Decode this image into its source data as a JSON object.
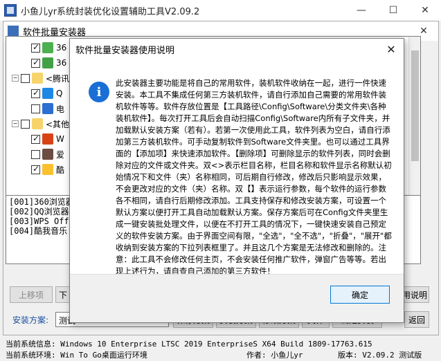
{
  "app": {
    "title": "小鱼儿yr系统封装优化设置辅助工具V2.09.2",
    "minimize_glyph": "—",
    "maximize_glyph": "☐",
    "close_glyph": "✕"
  },
  "installer": {
    "title": "软件批量安装器",
    "close_glyph": "✕",
    "tree": [
      {
        "label": "36",
        "checked": true,
        "icon": "360-green-icon"
      },
      {
        "label": "36",
        "checked": true,
        "icon": "360-green-icon"
      },
      {
        "label": "<腾讯",
        "checked": false,
        "icon": "folder-icon",
        "group": true
      },
      {
        "label": "Q",
        "checked": true,
        "icon": "qq-browser-icon"
      },
      {
        "label": "电",
        "checked": false,
        "icon": "shield-blue-icon"
      },
      {
        "label": "<其他",
        "checked": false,
        "icon": "folder-icon",
        "group": true
      },
      {
        "label": "W",
        "checked": true,
        "icon": "wps-icon"
      },
      {
        "label": "爱",
        "checked": false,
        "icon": "ai-icon"
      },
      {
        "label": "酷",
        "checked": true,
        "icon": "kugou-icon"
      }
    ],
    "log_lines": [
      "[001]360浏览器",
      "[002]QQ浏览器",
      "[003]WPS Offic",
      "[004]酷我音乐"
    ],
    "buttons": {
      "up": "上移项",
      "down": "下",
      "help": "用说明",
      "save": "保存方案",
      "apply": "安装方案",
      "edit": "修改方案",
      "extra": "文件",
      "confirm": "确定安装",
      "back": "返回"
    },
    "scheme_label": "安装方案:",
    "scheme_value": "测试"
  },
  "status": {
    "sysinfo": "当前系统信息: Windows 10 Enterprise LTSC 2019 EnterpriseS X64 Build 1809-17763.615",
    "sysenv": "当前系统环境: Win To Go桌面运行环境",
    "author": "作者: 小鱼儿yr",
    "version": "版本: V2.09.2 测试版"
  },
  "dialog": {
    "title": "软件批量安装器使用说明",
    "close_glyph": "✕",
    "info_glyph": "i",
    "body": "此安装器主要功能是将自己的常用软件，装机软件收纳在一起，进行一件快速安装。本工具不集成任何第三方装机软件，请自行添加自己需要的常用软件装机软件等等。软件存放位置是【工具路径\\Config\\Software\\分类文件夹\\各种装机软件】。每次打开工具后会自动扫描Config\\Software内所有子文件夹，并加载默认安装方案（若有）。若第一次使用此工具，软件列表为空白，请自行添加第三方装机软件。可手动复制软件到Software文件夹里。也可以通过工具界面的【添加项】来快速添加软件。【删除项】可删除显示的软件列表，同时会删除对应的文件或文件夹。双<>表示栏目名称，栏目名称和软件显示名称默认初始情况下和文件（夹）名称相同，可后期自行修改，修改后只影响显示效果，不会更改对应的文件（夹）名称。双【】表示运行参数，每个软件的运行参数各不相同，请自行后期修改添加。工具支持保存和修改安装方案，可设置一个默认方案以便打开工具自动加载默认方案。保存方案后可在Config文件夹里生成一键安装批处理文件，以便在不打开工具的情况下，一键快速安装自己预定义的软件安装方案。由于界面空间有限，\"全选\"，\"全不选\"，\"折叠\"，\"展开\"都收纳到安装方案的下拉列表框里了。并且这几个方案是无法修改和删除的。注意：此工具不会修改任何主页，不会安装任何推广软件，弹窗广告等等。若出现上述行为，请自查自己添加的第三方软件！",
    "ok": "确定"
  }
}
